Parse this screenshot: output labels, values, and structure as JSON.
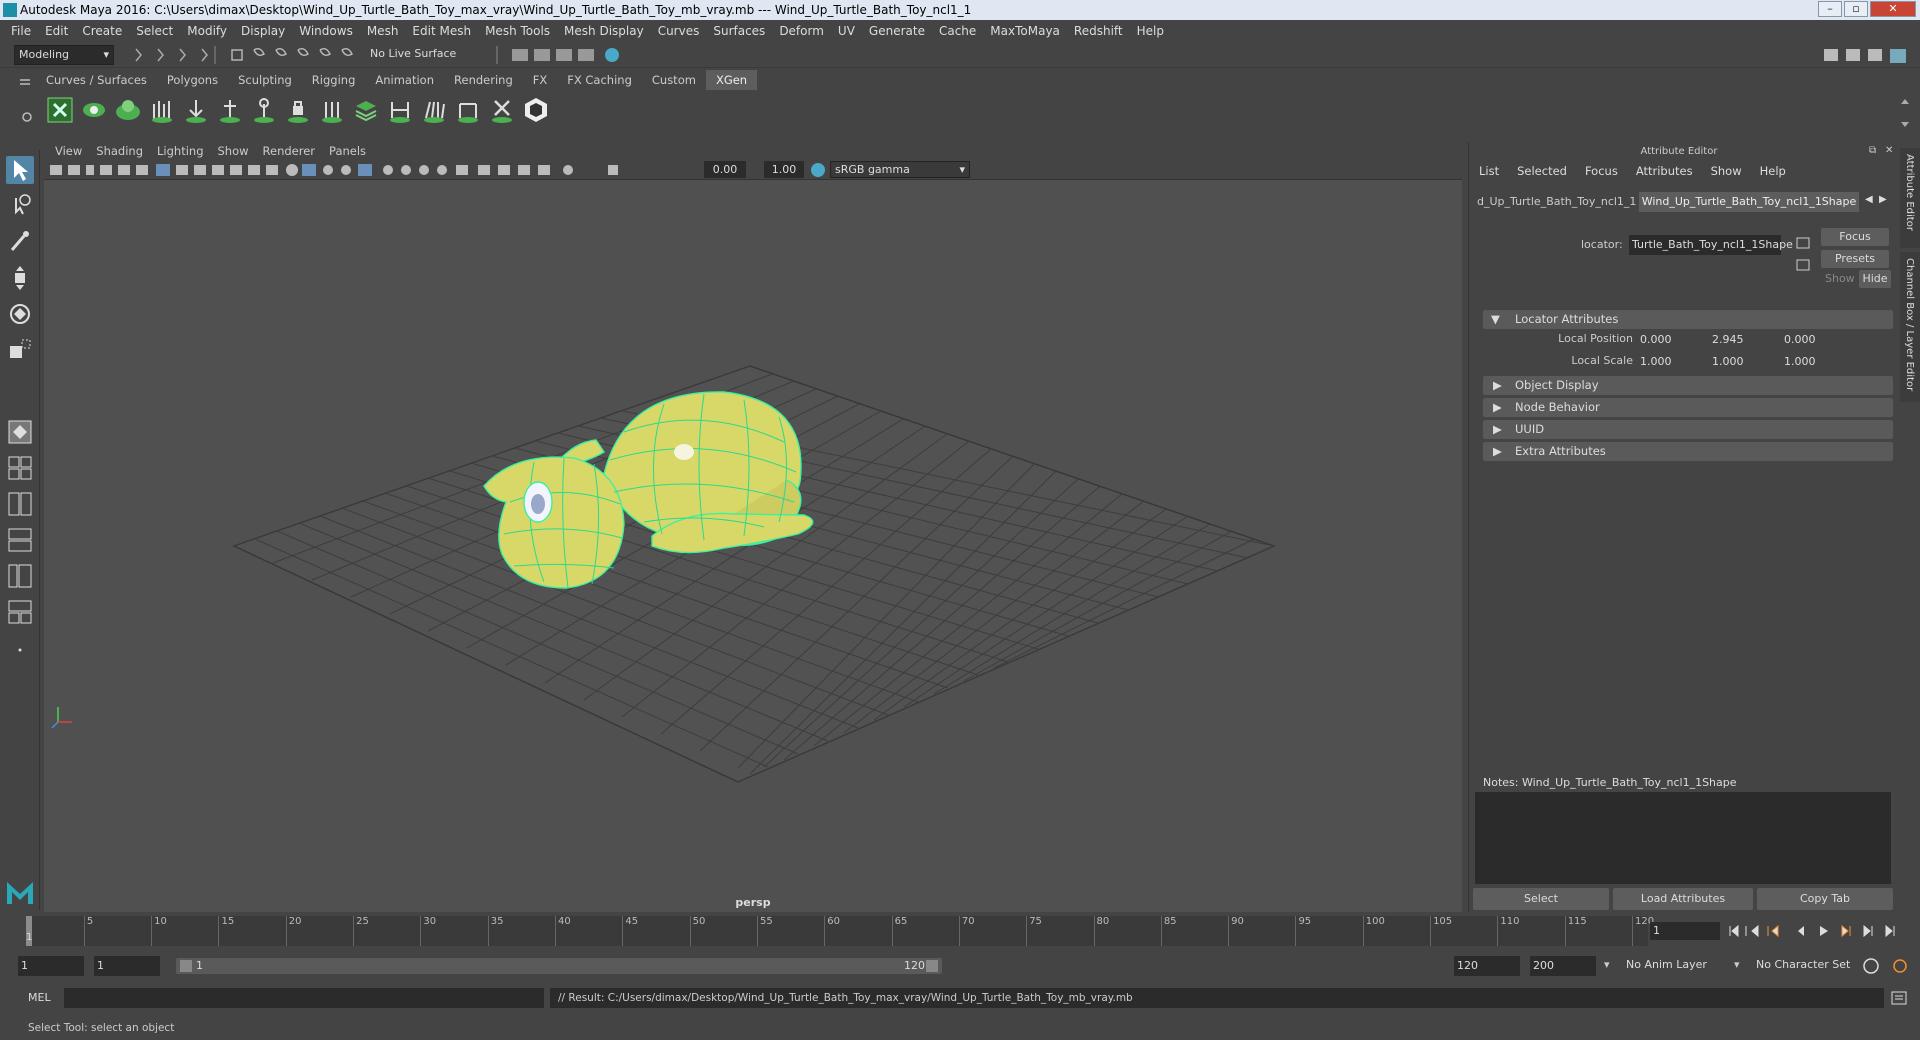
{
  "window": {
    "title": "Autodesk Maya 2016: C:\\Users\\dimax\\Desktop\\Wind_Up_Turtle_Bath_Toy_max_vray\\Wind_Up_Turtle_Bath_Toy_mb_vray.mb   ---   Wind_Up_Turtle_Bath_Toy_ncl1_1",
    "controls": [
      "–",
      "▫",
      "✕"
    ]
  },
  "menubar": [
    "File",
    "Edit",
    "Create",
    "Select",
    "Modify",
    "Display",
    "Windows",
    "Mesh",
    "Edit Mesh",
    "Mesh Tools",
    "Mesh Display",
    "Curves",
    "Surfaces",
    "Deform",
    "UV",
    "Generate",
    "Cache",
    "MaxToMaya",
    "Redshift",
    "Help"
  ],
  "statusline": {
    "mode": "Modeling",
    "live_surface": "No Live Surface"
  },
  "shelf": {
    "tabs": [
      "Curves / Surfaces",
      "Polygons",
      "Sculpting",
      "Rigging",
      "Animation",
      "Rendering",
      "FX",
      "FX Caching",
      "Custom",
      "XGen"
    ],
    "active_tab": "XGen"
  },
  "viewport": {
    "menu": [
      "View",
      "Shading",
      "Lighting",
      "Show",
      "Renderer",
      "Panels"
    ],
    "exposure": "0.00",
    "gamma": "1.00",
    "color_space": "sRGB gamma",
    "camera_label": "persp"
  },
  "attribute_editor": {
    "header": "Attribute Editor",
    "menu": [
      "List",
      "Selected",
      "Focus",
      "Attributes",
      "Show",
      "Help"
    ],
    "tabs": [
      "d_Up_Turtle_Bath_Toy_ncl1_1",
      "Wind_Up_Turtle_Bath_Toy_ncl1_1Shape"
    ],
    "locator_label": "locator:",
    "locator_value": "Turtle_Bath_Toy_ncl1_1Shape",
    "focus_btn": "Focus",
    "presets_btn": "Presets",
    "show_btn": "Show",
    "hide_btn": "Hide",
    "sections": [
      "Locator Attributes",
      "Object Display",
      "Node Behavior",
      "UUID",
      "Extra Attributes"
    ],
    "local_position_label": "Local Position",
    "local_position": [
      "0.000",
      "2.945",
      "0.000"
    ],
    "local_scale_label": "Local Scale",
    "local_scale": [
      "1.000",
      "1.000",
      "1.000"
    ],
    "notes": "Notes:  Wind_Up_Turtle_Bath_Toy_ncl1_1Shape",
    "bottom_buttons": [
      "Select",
      "Load Attributes",
      "Copy Tab"
    ],
    "side_tabs": [
      "Attribute Editor",
      "Channel Box / Layer Editor"
    ]
  },
  "timeline": {
    "ticks": [
      "5",
      "10",
      "15",
      "20",
      "25",
      "30",
      "35",
      "40",
      "45",
      "50",
      "55",
      "60",
      "65",
      "70",
      "75",
      "80",
      "85",
      "90",
      "95",
      "100",
      "105",
      "110",
      "115",
      "120"
    ],
    "start_marker": "1",
    "current_frame": "1"
  },
  "range": {
    "start": "1",
    "playback_start": "1",
    "slider_start": "1",
    "slider_end": "120",
    "playback_end": "120",
    "end": "200",
    "anim_layer": "No Anim Layer",
    "character_set": "No Character Set"
  },
  "cmdline": {
    "label": "MEL",
    "result": "// Result: C:/Users/dimax/Desktop/Wind_Up_Turtle_Bath_Toy_max_vray/Wind_Up_Turtle_Bath_Toy_mb_vray.mb"
  },
  "helpline": "Select Tool: select an object",
  "colors": {
    "mesh_fill": "#d8d868",
    "wireframe": "#38e8a0",
    "active_tab": "#5d5d5d",
    "shelf_icon_green": "#4caf50"
  }
}
